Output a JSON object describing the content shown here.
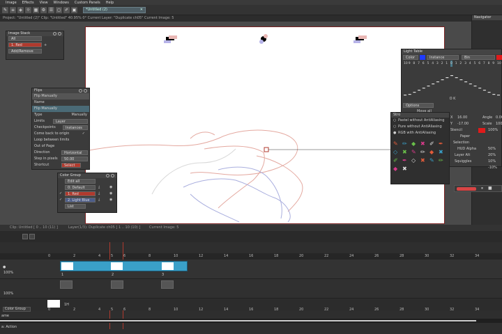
{
  "menu": [
    "Image",
    "Effects",
    "View",
    "Windows",
    "Custom Panels",
    "Help"
  ],
  "doc_tab": "*Untitled (2)",
  "status_line": "Project: \"Untitled (2)\" Clip: \"Untitled\"  40.95%  0° Current Layer: \"Duplicate ch05\"  Current Image: 5",
  "navigator_title": "Navigator",
  "image_stack": {
    "title": "Image Stack",
    "all_label": "All",
    "red_label": "1. Red",
    "add_remove_label": "Add/Remove"
  },
  "flips": {
    "title": "Flips",
    "dropdown": "Flip Manually",
    "name_header": "Name",
    "name_value": "Flip Manually",
    "rows": [
      {
        "label": "Type",
        "value": "Manually"
      },
      {
        "label": "Limits",
        "value": "Layer"
      },
      {
        "label": "Checkpoints",
        "value": "Instances"
      },
      {
        "label": "Come back to origin",
        "value": "✓"
      },
      {
        "label": "Loop between limits",
        "value": ""
      },
      {
        "label": "Out of Page",
        "value": ""
      },
      {
        "label": "Direction",
        "value": "Horizontal"
      },
      {
        "label": "Step in pixels",
        "value": "50.00"
      },
      {
        "label": "Shortcut",
        "value": "Select"
      }
    ]
  },
  "color_group": {
    "title": "Color Group",
    "edit_all": "Edit all",
    "items": [
      "0: Default",
      "1. Red",
      "2. Light Blue"
    ],
    "list_label": "List"
  },
  "light_table": {
    "title": "Light Table",
    "color_label": "Color",
    "instance_label": "Instance",
    "bin_label": "Bin",
    "numbers": [
      "10",
      "9",
      "8",
      "7",
      "6",
      "5",
      "4",
      "3",
      "2",
      "1",
      "0",
      "1",
      "2",
      "3",
      "4",
      "5",
      "6",
      "7",
      "8",
      "9",
      "10"
    ],
    "options_label": "Options",
    "move_all_label": "Move all",
    "x_label": "X",
    "x_value": "16.00",
    "y_label": "Y",
    "y_value": "-17.00",
    "angle_label": "Angle",
    "angle_value": "0.00",
    "scale_label": "Scale",
    "scale_value": "100",
    "stencil_label": "Stencil",
    "stencil_value": "100%",
    "paper_label": "Paper",
    "selection_label": "Selection",
    "hud_alpha_label": "HUD Alpha",
    "hud_alpha_value": "50%",
    "layer_alt_label": "Layer Alt",
    "layer_alt_value": "20%",
    "squiggles_label": "Squiggles",
    "squiggles_value_1": "10%",
    "squiggles_value_2": "-10%"
  },
  "stroke_menu": {
    "title": "Stro",
    "options": [
      "Pastel without AntiAliasing",
      "Pure without AntiAliasing",
      "RGB with AntiAliasing"
    ]
  },
  "timeline": {
    "clip_info": "Clip: Untitled [ 0 .. 10 (11) ]",
    "layer_info": "Layer(1/3): Duplicate ch05 [ 1 .. 10 (10) ]",
    "current_image": "Current Image: 5",
    "ruler": [
      "0",
      "2",
      "4",
      "5",
      "6",
      "8",
      "10",
      "12",
      "14",
      "16",
      "18",
      "20",
      "22",
      "24",
      "26",
      "28",
      "30",
      "32",
      "34"
    ],
    "clip_labels": [
      "1",
      "2",
      "3"
    ],
    "opacity_1": "100%",
    "opacity_2": "100%",
    "color_group_tab": "Color Group",
    "frame_label": "1H",
    "bottom_left": "a: Action",
    "bottom_label": "ame"
  },
  "colors": {
    "accent_red": "#b03a2e",
    "clip_blue": "#3aa0c8",
    "light_blue": "#4d5d8a"
  }
}
